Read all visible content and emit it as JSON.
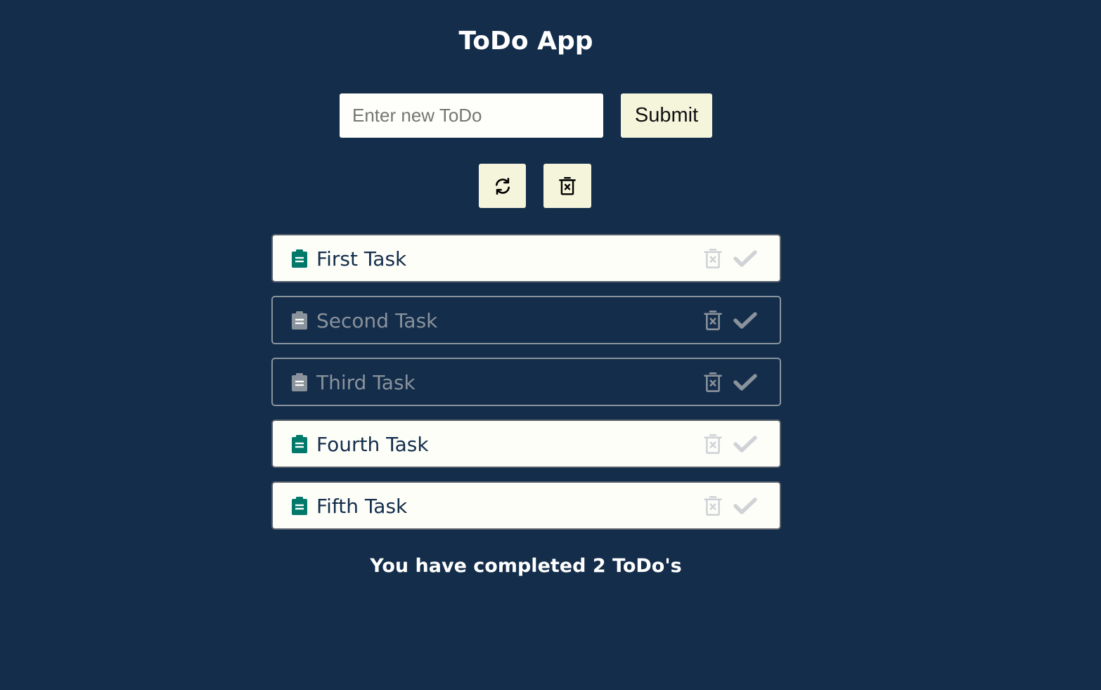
{
  "app": {
    "title": "ToDo App"
  },
  "form": {
    "input_placeholder": "Enter new ToDo",
    "input_value": "",
    "submit_label": "Submit"
  },
  "toolbar": {
    "refresh_icon": "refresh-icon",
    "clear_icon": "trash-x-icon"
  },
  "tasks": [
    {
      "text": "First Task",
      "completed": false
    },
    {
      "text": "Second Task",
      "completed": true
    },
    {
      "text": "Third Task",
      "completed": true
    },
    {
      "text": "Fourth Task",
      "completed": false
    },
    {
      "text": "Fifth Task",
      "completed": false
    }
  ],
  "summary": {
    "text": "You have completed 2 ToDo's"
  },
  "colors": {
    "background": "#132d4b",
    "button": "#f5f5dc",
    "task_active_bg": "#fefef9",
    "task_icon_active": "#00796b",
    "task_icon_done": "#8a929b",
    "action_icon_active": "#cfd2d6",
    "action_icon_done": "#8a929b"
  }
}
